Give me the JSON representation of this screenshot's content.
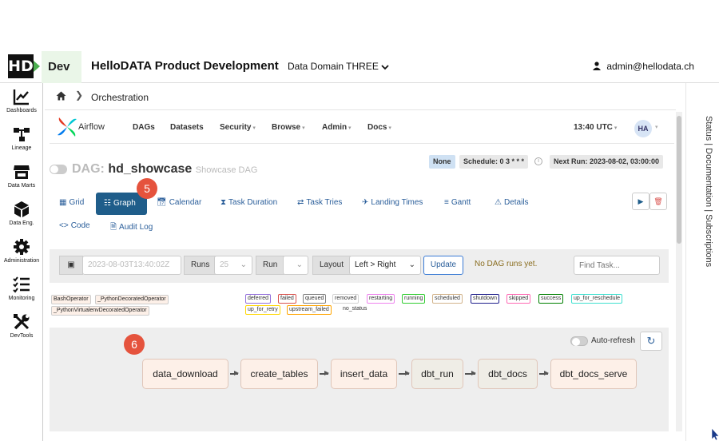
{
  "header": {
    "env": "Dev",
    "title": "HelloDATA Product Development",
    "domain": "Data Domain THREE",
    "user": "admin@hellodata.ch",
    "logo_text": "HD"
  },
  "sidebar": {
    "items": [
      {
        "label": "Dashboards",
        "icon": "chart-line-icon"
      },
      {
        "label": "Lineage",
        "icon": "lineage-icon"
      },
      {
        "label": "Data Marts",
        "icon": "store-icon"
      },
      {
        "label": "Data Eng.",
        "icon": "cube-icon"
      },
      {
        "label": "Administration",
        "icon": "gear-icon"
      },
      {
        "label": "Monitoring",
        "icon": "list-check-icon"
      },
      {
        "label": "DevTools",
        "icon": "tools-icon"
      }
    ]
  },
  "breadcrumb": {
    "current": "Orchestration"
  },
  "airflow": {
    "brand": "Airflow",
    "menu": [
      "DAGs",
      "Datasets",
      "Security",
      "Browse",
      "Admin",
      "Docs"
    ],
    "time": "13:40 UTC",
    "avatar": "HA"
  },
  "dag": {
    "prefix": "DAG:",
    "name": "hd_showcase",
    "subtitle": "Showcase DAG",
    "none_badge": "None",
    "schedule": "Schedule: 0 3 * * *",
    "next_run": "Next Run: 2023-08-02, 03:00:00"
  },
  "tabs": {
    "grid": "Grid",
    "graph": "Graph",
    "calendar": "Calendar",
    "task_duration": "Task Duration",
    "task_tries": "Task Tries",
    "landing_times": "Landing Times",
    "gantt": "Gantt",
    "details": "Details",
    "code": "Code",
    "audit_log": "Audit Log"
  },
  "annotations": {
    "five": "5",
    "six": "6"
  },
  "toolbar": {
    "date": "2023-08-03T13:40:02Z",
    "runs_label": "Runs",
    "runs_value": "25",
    "run_label": "Run",
    "layout_label": "Layout",
    "layout_value": "Left > Right",
    "update": "Update",
    "no_runs": "No DAG runs yet.",
    "find_placeholder": "Find Task..."
  },
  "legend_ops": [
    "BashOperator",
    "_PythonDecoratedOperator",
    "_PythonVirtualenvDecoratedOperator"
  ],
  "legend_states": [
    {
      "label": "deferred",
      "color": "#9370db"
    },
    {
      "label": "failed",
      "color": "#d9534f"
    },
    {
      "label": "queued",
      "color": "#808080"
    },
    {
      "label": "removed",
      "color": "#d3d3d3"
    },
    {
      "label": "restarting",
      "color": "#ee82ee"
    },
    {
      "label": "running",
      "color": "#32cd32"
    },
    {
      "label": "scheduled",
      "color": "#d2b48c"
    },
    {
      "label": "shutdown",
      "color": "#1e1e8c"
    },
    {
      "label": "skipped",
      "color": "#ff69b4"
    },
    {
      "label": "success",
      "color": "#008000"
    },
    {
      "label": "up_for_reschedule",
      "color": "#40e0d0"
    },
    {
      "label": "up_for_retry",
      "color": "#ffd700"
    },
    {
      "label": "upstream_failed",
      "color": "#ffa500"
    },
    {
      "label": "no_status",
      "color": "#ffffff"
    }
  ],
  "graph": {
    "auto_refresh": "Auto-refresh",
    "nodes": [
      {
        "label": "data_download",
        "color": "#fdf0e8"
      },
      {
        "label": "create_tables",
        "color": "#fdf0e8"
      },
      {
        "label": "insert_data",
        "color": "#fdf0e8"
      },
      {
        "label": "dbt_run",
        "color": "#efede6"
      },
      {
        "label": "dbt_docs",
        "color": "#efede6"
      },
      {
        "label": "dbt_docs_serve",
        "color": "#fdf0e8"
      }
    ]
  },
  "right_panel": {
    "label": "Status | Documentation | Subscriptions"
  }
}
